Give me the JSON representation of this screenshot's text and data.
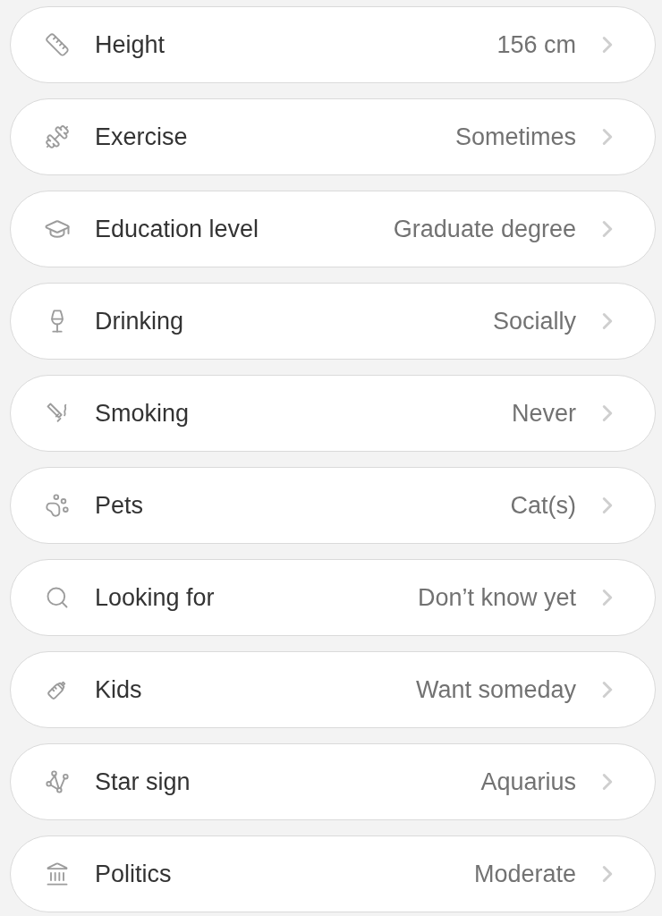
{
  "fields": [
    {
      "label": "Height",
      "value": "156 cm"
    },
    {
      "label": "Exercise",
      "value": "Sometimes"
    },
    {
      "label": "Education level",
      "value": "Graduate degree"
    },
    {
      "label": "Drinking",
      "value": "Socially"
    },
    {
      "label": "Smoking",
      "value": "Never"
    },
    {
      "label": "Pets",
      "value": "Cat(s)"
    },
    {
      "label": "Looking for",
      "value": "Don’t know yet"
    },
    {
      "label": "Kids",
      "value": "Want someday"
    },
    {
      "label": "Star sign",
      "value": "Aquarius"
    },
    {
      "label": "Politics",
      "value": "Moderate"
    }
  ]
}
